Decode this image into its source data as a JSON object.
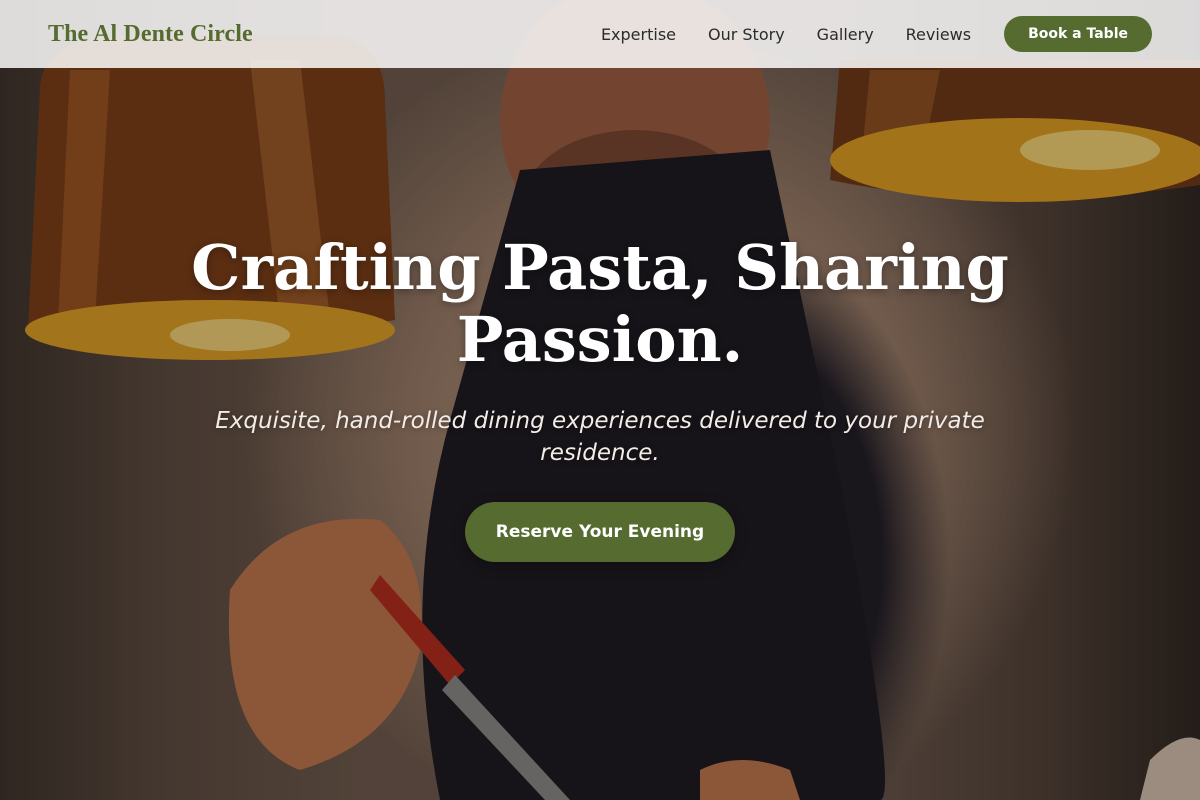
{
  "brand": {
    "name": "The Al Dente Circle"
  },
  "nav": {
    "links": [
      "Expertise",
      "Our Story",
      "Gallery",
      "Reviews"
    ],
    "cta_label": "Book a Table"
  },
  "hero": {
    "title": "Crafting Pasta, Sharing Passion.",
    "subtitle": "Exquisite, hand-rolled dining experiences delivered to your private residence.",
    "cta_label": "Reserve Your Evening"
  },
  "colors": {
    "accent": "#556b2f",
    "header_bg": "#ffffff",
    "hero_text": "#ffffff"
  }
}
